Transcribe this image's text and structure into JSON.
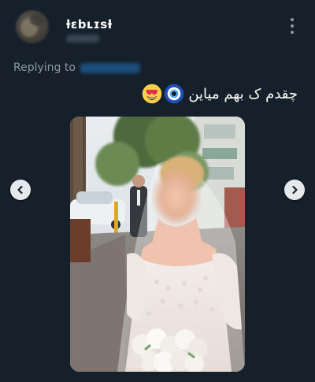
{
  "tweet": {
    "display_name": "ƚɛbʟɪsƚ",
    "replying_prefix": "Replying to",
    "text": "چقدم ک بهم میاین",
    "emojis": [
      "smiling-face-with-heart-eyes",
      "nazar-amulet"
    ]
  },
  "media": {
    "description_icons": [
      "chevron-left-icon",
      "chevron-right-icon"
    ]
  },
  "colors": {
    "background": "#15202b",
    "secondary_text": "#8b98a5",
    "primary_text": "#ffffff"
  }
}
